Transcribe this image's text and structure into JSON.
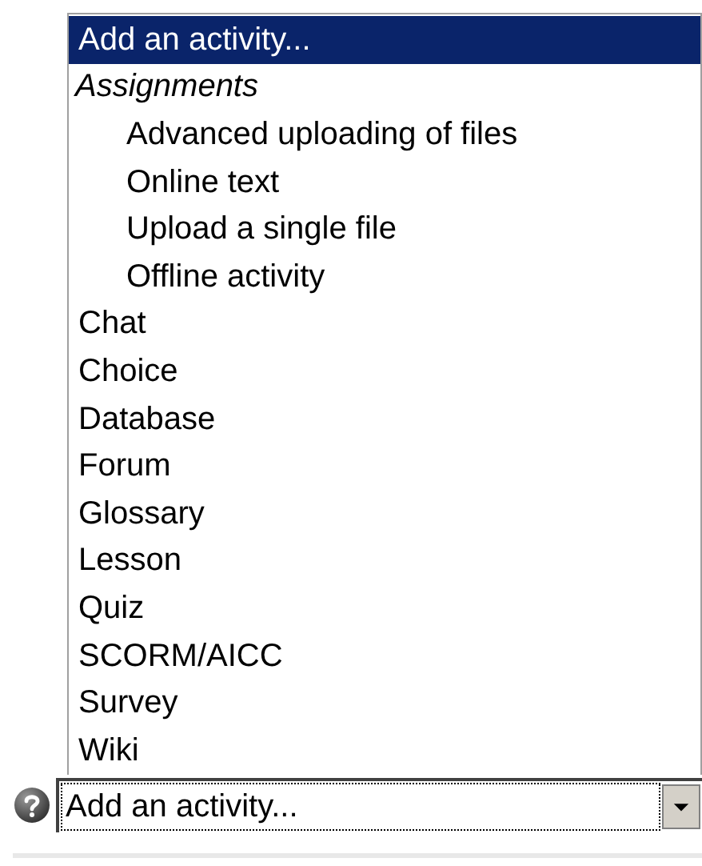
{
  "dropdown_list": {
    "options": [
      {
        "kind": "option",
        "label": "Add an activity...",
        "selected": true
      },
      {
        "kind": "group",
        "label": "Assignments",
        "children": [
          {
            "kind": "option",
            "label": "Advanced uploading of files",
            "selected": false
          },
          {
            "kind": "option",
            "label": "Online text",
            "selected": false
          },
          {
            "kind": "option",
            "label": "Upload a single file",
            "selected": false
          },
          {
            "kind": "option",
            "label": "Offline activity",
            "selected": false
          }
        ]
      },
      {
        "kind": "option",
        "label": "Chat",
        "selected": false
      },
      {
        "kind": "option",
        "label": "Choice",
        "selected": false
      },
      {
        "kind": "option",
        "label": "Database",
        "selected": false
      },
      {
        "kind": "option",
        "label": "Forum",
        "selected": false
      },
      {
        "kind": "option",
        "label": "Glossary",
        "selected": false
      },
      {
        "kind": "option",
        "label": "Lesson",
        "selected": false
      },
      {
        "kind": "option",
        "label": "Quiz",
        "selected": false
      },
      {
        "kind": "option",
        "label": "SCORM/AICC",
        "selected": false
      },
      {
        "kind": "option",
        "label": "Survey",
        "selected": false
      },
      {
        "kind": "option",
        "label": "Wiki",
        "selected": false
      }
    ]
  },
  "select": {
    "value": "Add an activity..."
  }
}
